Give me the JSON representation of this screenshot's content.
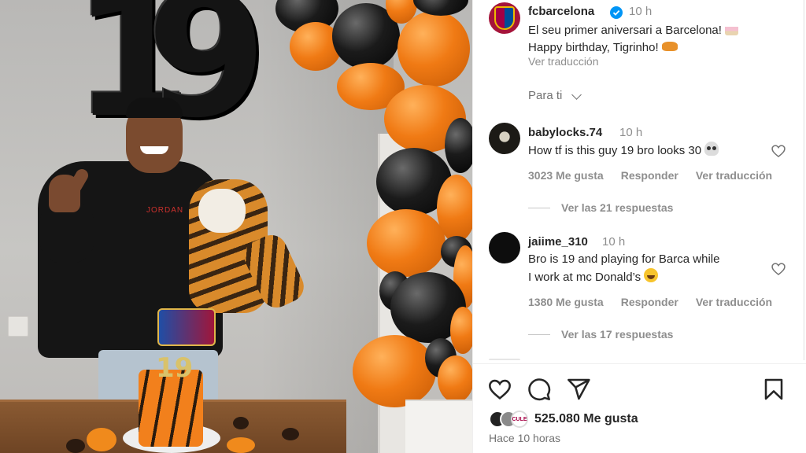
{
  "post": {
    "author": "fcbarcelona",
    "verified": true,
    "time_ago": "10 h",
    "caption_line1": "El seu primer aniversari a Barcelona!",
    "caption_line2": "Happy birthday, Tigrinho!",
    "see_translation": "Ver traducción",
    "sort_label": "Para ti",
    "photo": {
      "balloon_digits": "19",
      "shirt_text": "JORDAN",
      "cake_number": "19"
    }
  },
  "comments": [
    {
      "username": "babylocks.74",
      "time_ago": "10 h",
      "text": "How tf is this guy 19 bro looks 30",
      "emoji": "skull",
      "likes": "3023 Me gusta",
      "reply": "Responder",
      "translate": "Ver traducción",
      "view_replies": "Ver las 21 respuestas"
    },
    {
      "username": "jaiime_310",
      "time_ago": "10 h",
      "text_line1": "Bro is 19 and playing for Barca while",
      "text_line2": "I work at mc Donald’s",
      "emoji": "face-with-tears-of-joy",
      "likes": "1380 Me gusta",
      "reply": "Responder",
      "translate": "Ver traducción",
      "view_replies": "Ver las 17 respuestas"
    }
  ],
  "actions": {
    "icons": [
      "heart-icon",
      "comment-icon",
      "share-icon",
      "bookmark-icon"
    ],
    "likes_count": "525.080 Me gusta",
    "liker_badge": "CULE",
    "posted": "Hace 10 horas"
  },
  "colors": {
    "verified_blue": "#0095f6",
    "balloon_orange": "#f07a14",
    "balloon_black": "#111111",
    "text_primary": "#262626",
    "text_secondary": "#8e8e8e"
  }
}
